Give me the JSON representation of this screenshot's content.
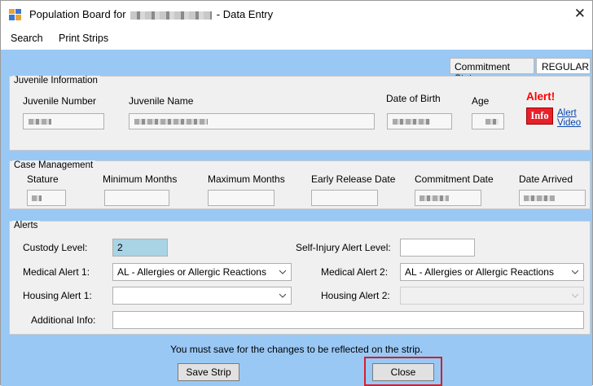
{
  "window": {
    "title_prefix": "Population Board for",
    "title_suffix": "- Data Entry",
    "close_glyph": "✕"
  },
  "menu": [
    "Search",
    "Print Strips"
  ],
  "commitment": {
    "label": "Commitment Status",
    "value": "REGULAR"
  },
  "juvenile_info": {
    "title": "Juvenile Information",
    "number_label": "Juvenile Number",
    "name_label": "Juvenile Name",
    "dob_label": "Date of Birth",
    "age_label": "Age",
    "alert_title": "Alert!",
    "info_button": "Info",
    "alert_link": "Alert",
    "video_link": "Video"
  },
  "case_management": {
    "title": "Case Management",
    "labels": [
      "Stature",
      "Minimum Months",
      "Maximum Months",
      "Early Release Date",
      "Commitment Date",
      "Date Arrived"
    ]
  },
  "alerts": {
    "title": "Alerts",
    "custody_label": "Custody Level:",
    "custody_value": "2",
    "self_injury_label": "Self-Injury Alert Level:",
    "self_injury_value": "",
    "medical1_label": "Medical Alert 1:",
    "medical1_value": "AL - Allergies or Allergic Reactions",
    "medical2_label": "Medical Alert 2:",
    "medical2_value": "AL - Allergies or Allergic Reactions",
    "housing1_label": "Housing Alert 1:",
    "housing1_value": "",
    "housing2_label": "Housing Alert 2:",
    "housing2_value": "",
    "additional_label": "Additional Info:",
    "additional_value": ""
  },
  "footer": {
    "notice": "You must save for the changes to be reflected on the strip.",
    "save_button": "Save Strip",
    "close_button": "Close"
  },
  "colors": {
    "form_background": "#99c8f5",
    "alert_red": "#ff0000",
    "custody_highlight": "#a8d4e6",
    "focus_outline": "#d3202a"
  }
}
